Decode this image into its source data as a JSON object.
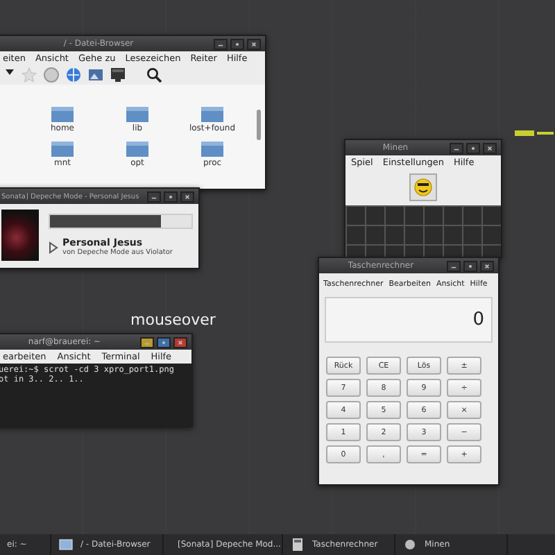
{
  "desktop": {
    "overlay_text": "mouseover"
  },
  "file_browser": {
    "title": "/ - Datei-Browser",
    "menu": [
      "eiten",
      "Ansicht",
      "Gehe zu",
      "Lesezeichen",
      "Reiter",
      "Hilfe"
    ],
    "folders": [
      "home",
      "lib",
      "lost+found",
      "mnt",
      "opt",
      "proc"
    ]
  },
  "music_player": {
    "title": "Sonata] Depeche Mode - Personal Jesus",
    "progress": {
      "level": 0.78
    },
    "song": "Personal Jesus",
    "details": "von Depeche Mode aus Violator"
  },
  "terminal": {
    "title": "narf@brauerei: ~",
    "window_buttons": [
      {
        "color": "#b89a2e"
      },
      {
        "color": "#3d6fa8"
      },
      {
        "color": "#b8392e"
      }
    ],
    "menu": [
      "earbeiten",
      "Ansicht",
      "Terminal",
      "Hilfe"
    ],
    "lines": [
      "uerei:~$ scrot -cd 3 xpro_port1.png",
      "ot in 3.. 2.. 1.."
    ]
  },
  "mines": {
    "title": "Minen",
    "menu": [
      "Spiel",
      "Einstellungen",
      "Hilfe"
    ]
  },
  "calculator": {
    "title": "Taschenrechner",
    "menu": [
      "Taschenrechner",
      "Bearbeiten",
      "Ansicht",
      "Hilfe"
    ],
    "display": "0",
    "keys": [
      [
        "Rück",
        "CE",
        "Lös",
        "±"
      ],
      [
        "7",
        "8",
        "9",
        "÷"
      ],
      [
        "4",
        "5",
        "6",
        "×"
      ],
      [
        "1",
        "2",
        "3",
        "−"
      ],
      [
        "0",
        ",",
        "=",
        "+"
      ]
    ]
  },
  "taskbar": {
    "items": [
      {
        "label": "ei: ~",
        "kind": "plain"
      },
      {
        "label": "/ - Datei-Browser",
        "kind": "folder"
      },
      {
        "label": "[Sonata] Depeche Mod...",
        "kind": "music"
      },
      {
        "label": "Taschenrechner",
        "kind": "calculator"
      },
      {
        "label": "Minen",
        "kind": "mines"
      }
    ]
  }
}
